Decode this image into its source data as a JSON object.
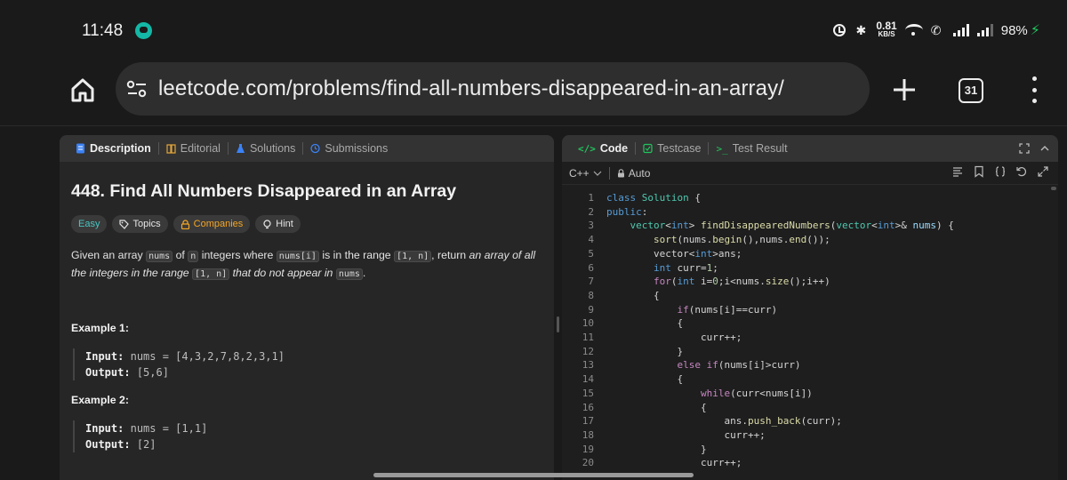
{
  "status": {
    "time": "11:48",
    "net_speed": "0.81",
    "net_unit": "KB/S",
    "battery": "98%"
  },
  "browser": {
    "url": "leetcode.com/problems/find-all-numbers-disappeared-in-an-array/",
    "tab_count": "31"
  },
  "left_tabs": [
    "Description",
    "Editorial",
    "Solutions",
    "Submissions"
  ],
  "problem": {
    "title": "448. Find All Numbers Disappeared in an Array",
    "tags": [
      "Easy",
      "Topics",
      "Companies",
      "Hint"
    ],
    "desc": {
      "p1": "Given an array ",
      "c1": "nums",
      "p2": " of ",
      "c2": "n",
      "p3": " integers where ",
      "c3": "nums[i]",
      "p4": " is in the range ",
      "c4": "[1, n]",
      "p5": ", return ",
      "e1": "an array of all the integers in the range ",
      "c5": "[1, n]",
      "e2": " that do not appear in ",
      "c6": "nums",
      "p6": "."
    },
    "examples": [
      {
        "title": "Example 1:",
        "input_label": "Input:",
        "input": "nums = [4,3,2,7,8,2,3,1]",
        "output_label": "Output:",
        "output": "[5,6]"
      },
      {
        "title": "Example 2:",
        "input_label": "Input:",
        "input": "nums = [1,1]",
        "output_label": "Output:",
        "output": "[2]"
      }
    ]
  },
  "right_tabs": [
    "Code",
    "Testcase",
    "Test Result"
  ],
  "editor": {
    "language": "C++",
    "mode": "Auto",
    "line_numbers": [
      "1",
      "2",
      "3",
      "4",
      "5",
      "6",
      "7",
      "8",
      "9",
      "10",
      "11",
      "12",
      "13",
      "14",
      "15",
      "16",
      "17",
      "18",
      "19",
      "20"
    ]
  },
  "colors": {
    "easy": "#46c6c2",
    "companies": "#f5a623",
    "code_tab": "#22c55e",
    "charging": "#22c55e"
  }
}
